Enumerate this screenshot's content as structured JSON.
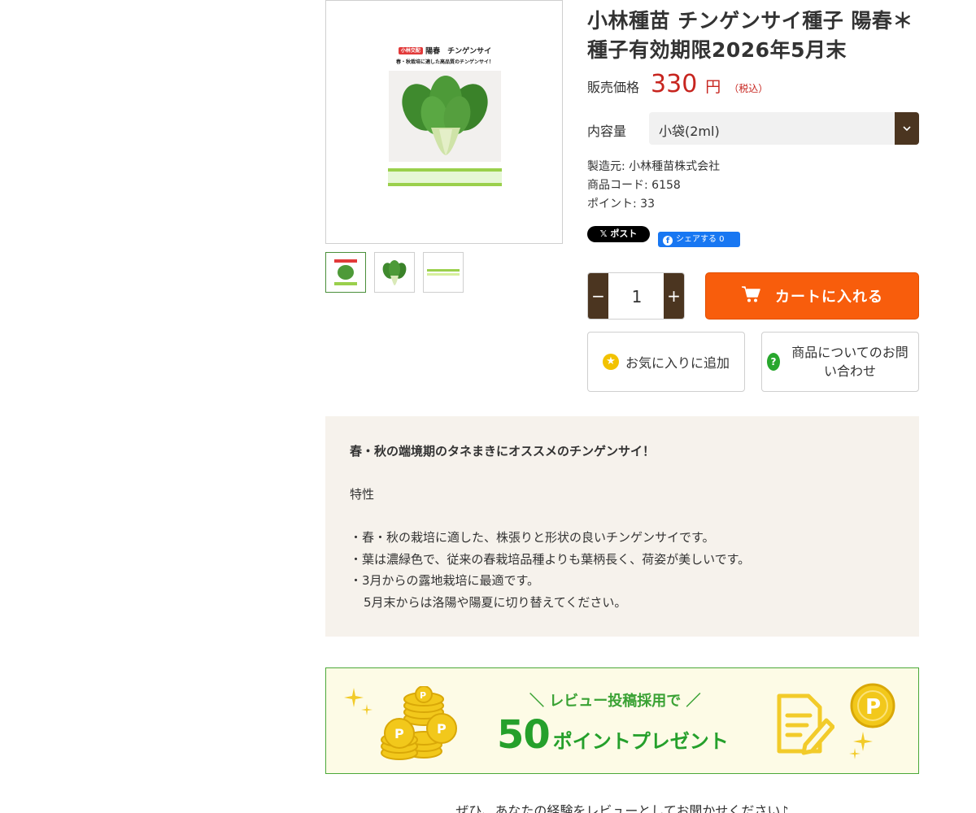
{
  "product": {
    "title": "小林種苗 チンゲンサイ種子 陽春＊種子有効期限2026年5月末",
    "price_label": "販売価格",
    "price_value": "330",
    "price_unit": "円",
    "price_tax": "（税込）",
    "volume_label": "内容量",
    "volume_selected": "小袋(2ml)",
    "maker": "製造元: 小林種苗株式会社",
    "code": "商品コード: 6158",
    "points": "ポイント: 33",
    "package_tag": "小林交配",
    "package_name": "陽春　チンゲンサイ",
    "package_tagline": "春・秋栽培に適した高品質のチンゲンサイ！"
  },
  "social": {
    "x_post": "ポスト",
    "fb_share": "シェアする 0"
  },
  "cart": {
    "quantity": "1",
    "add_to_cart": "カートに入れる",
    "favorite": "お気に入りに追加",
    "inquiry": "商品についてのお問い合わせ"
  },
  "description": {
    "lead": "春・秋の端境期のタネまきにオススメのチンゲンサイ！",
    "heading": "特性",
    "bullets": [
      "・春・秋の栽培に適した、株張りと形状の良いチンゲンサイです。",
      "・葉は濃緑色で、従来の春栽培品種よりも葉柄長く、荷姿が美しいです。",
      "・3月からの露地栽培に最適です。"
    ],
    "continuation": "5月末からは洛陽や陽夏に切り替えてください。"
  },
  "banner": {
    "title": "＼ レビュー投稿採用で ／",
    "points_number": "50",
    "points_text": "ポイントプレゼント"
  },
  "footer_text": "ぜひ、あなたの経験をレビューとしてお聞かせください♪",
  "colors": {
    "price": "#c7251f",
    "cart_button": "#f85d0c",
    "brown_accent": "#4b3520",
    "banner_green": "#25a02b",
    "description_bg": "#f6f2ec"
  }
}
